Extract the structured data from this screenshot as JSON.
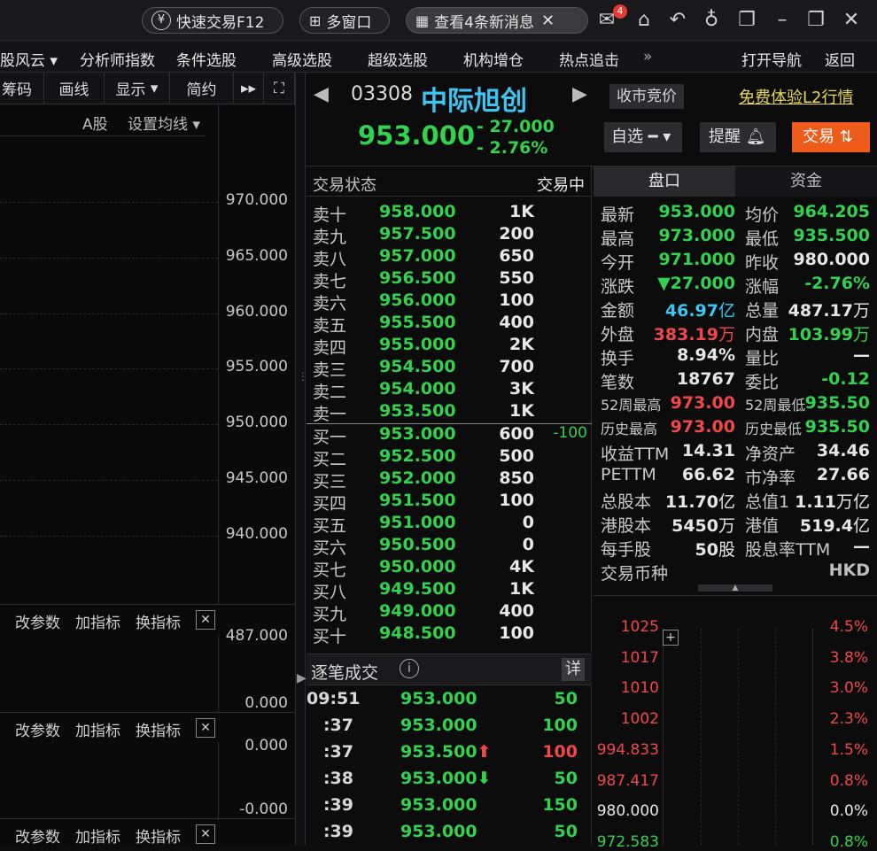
{
  "topbar": {
    "quick_trade": "快速交易F12",
    "multi_window": "多窗口",
    "messages": "查看4条新消息",
    "badge": "4"
  },
  "menu": {
    "items": [
      "股风云",
      "分析师指数",
      "条件选股",
      "高级选股",
      "超级选股",
      "机构增仓",
      "热点追击"
    ],
    "more": "»",
    "nav": "打开导航",
    "back": "返回"
  },
  "left": {
    "tools": [
      "筹码",
      "画线",
      "显示",
      "简约"
    ],
    "ashare": "A股",
    "ma_setting": "设置均线",
    "yaxis": [
      "970.000",
      "965.000",
      "960.000",
      "955.000",
      "950.000",
      "945.000",
      "940.000"
    ],
    "sub1": {
      "labels": [
        "改参数",
        "加指标",
        "换指标"
      ],
      "top": "487.000",
      "bottom": "0.000"
    },
    "sub2": {
      "labels": [
        "改参数",
        "加指标",
        "换指标"
      ],
      "top": "0.000",
      "bottom": "-0.000"
    },
    "sub3": {
      "labels": [
        "改参数",
        "加指标",
        "换指标"
      ]
    }
  },
  "quote": {
    "code": "03308",
    "name": "中际旭创",
    "status_btn": "收市竞价",
    "l2": "免费体验L2行情",
    "price": "953.000",
    "change": "- 27.000",
    "change_pct": "- 2.76%",
    "watch": "自选",
    "remind": "提醒",
    "trade": "交易"
  },
  "book": {
    "status_label": "交易状态",
    "status": "交易中",
    "sells": [
      [
        "卖十",
        "958.000",
        "1K"
      ],
      [
        "卖九",
        "957.500",
        "200"
      ],
      [
        "卖八",
        "957.000",
        "650"
      ],
      [
        "卖七",
        "956.500",
        "550"
      ],
      [
        "卖六",
        "956.000",
        "100"
      ],
      [
        "卖五",
        "955.500",
        "400"
      ],
      [
        "卖四",
        "955.000",
        "2K"
      ],
      [
        "卖三",
        "954.500",
        "700"
      ],
      [
        "卖二",
        "954.000",
        "3K"
      ],
      [
        "卖一",
        "953.500",
        "1K"
      ]
    ],
    "buys": [
      [
        "买一",
        "953.000",
        "600",
        "-100"
      ],
      [
        "买二",
        "952.500",
        "500",
        ""
      ],
      [
        "买三",
        "952.000",
        "850",
        ""
      ],
      [
        "买四",
        "951.500",
        "100",
        ""
      ],
      [
        "买五",
        "951.000",
        "0",
        ""
      ],
      [
        "买六",
        "950.500",
        "0",
        ""
      ],
      [
        "买七",
        "950.000",
        "4K",
        ""
      ],
      [
        "买八",
        "949.500",
        "1K",
        ""
      ],
      [
        "买九",
        "949.000",
        "400",
        ""
      ],
      [
        "买十",
        "948.500",
        "100",
        ""
      ]
    ]
  },
  "tabs": {
    "pankou": "盘口",
    "funds": "资金"
  },
  "stats": [
    {
      "l1": "最新",
      "v1": "953.000",
      "c1": "g",
      "l2": "均价",
      "v2": "964.205",
      "c2": "g"
    },
    {
      "l1": "最高",
      "v1": "973.000",
      "c1": "g",
      "l2": "最低",
      "v2": "935.500",
      "c2": "g"
    },
    {
      "l1": "今开",
      "v1": "971.000",
      "c1": "g",
      "l2": "昨收",
      "v2": "980.000",
      "c2": "w"
    },
    {
      "l1": "涨跌",
      "v1": "▼27.000",
      "c1": "g",
      "l2": "涨幅",
      "v2": "-2.76%",
      "c2": "g"
    },
    {
      "l1": "金额",
      "v1": "46.97",
      "u1": "亿",
      "c1": "c",
      "l2": "总量",
      "v2": "487.17",
      "u2": "万",
      "c2": "w"
    },
    {
      "l1": "外盘",
      "v1": "383.19",
      "u1": "万",
      "c1": "r",
      "l2": "内盘",
      "v2": "103.99",
      "u2": "万",
      "c2": "g"
    },
    {
      "l1": "换手",
      "v1": "8.94%",
      "c1": "w",
      "l2": "量比",
      "v2": "—",
      "c2": "w"
    },
    {
      "l1": "笔数",
      "v1": "18767",
      "c1": "w",
      "l2": "委比",
      "v2": "-0.12",
      "c2": "g"
    },
    {
      "l1": "52周最高",
      "v1": "973.00",
      "c1": "r",
      "l2": "52周最低",
      "v2": "935.50",
      "c2": "g",
      "small": true
    },
    {
      "l1": "历史最高",
      "v1": "973.00",
      "c1": "r",
      "l2": "历史最低",
      "v2": "935.50",
      "c2": "g",
      "small": true
    },
    {
      "l1": "收益TTM",
      "v1": "14.31",
      "c1": "w",
      "l2": "净资产",
      "v2": "34.46",
      "c2": "w"
    },
    {
      "l1": "PETTM",
      "v1": "66.62",
      "c1": "w",
      "l2": "市净率",
      "v2": "27.66",
      "c2": "w"
    },
    {
      "l1": "总股本",
      "v1": "11.70",
      "u1": "亿",
      "c1": "w",
      "l2": "总值1",
      "v2": "1.11",
      "u2": "万亿",
      "c2": "w"
    },
    {
      "l1": "港股本",
      "v1": "5450",
      "u1": "万",
      "c1": "w",
      "l2": "港值",
      "v2": "519.4",
      "u2": "亿",
      "c2": "w"
    },
    {
      "l1": "每手股",
      "v1": "50",
      "u1": "股",
      "c1": "w",
      "l2": "股息率TTM",
      "v2": "—",
      "c2": "w"
    },
    {
      "l1": "交易币种",
      "v1": "",
      "c1": "w",
      "l2": "",
      "v2": "HKD",
      "c2": "gr"
    }
  ],
  "ticks": {
    "title": "逐笔成交",
    "detail": "详",
    "rows": [
      [
        "09:51",
        "953.000",
        "50",
        "g",
        "g",
        ""
      ],
      [
        ":37",
        "953.000",
        "100",
        "g",
        "g",
        ""
      ],
      [
        ":37",
        "953.500",
        "100",
        "g",
        "r",
        "up"
      ],
      [
        ":38",
        "953.000",
        "50",
        "g",
        "g",
        "down"
      ],
      [
        ":39",
        "953.000",
        "150",
        "g",
        "g",
        ""
      ],
      [
        ":39",
        "953.000",
        "50",
        "g",
        "g",
        ""
      ]
    ]
  },
  "mini": {
    "left": [
      [
        "1025",
        "r"
      ],
      [
        "1017",
        "r"
      ],
      [
        "1010",
        "r"
      ],
      [
        "1002",
        "r"
      ],
      [
        "994.833",
        "r"
      ],
      [
        "987.417",
        "r"
      ],
      [
        "980.000",
        "w"
      ],
      [
        "972.583",
        "g"
      ]
    ],
    "right": [
      [
        "4.5%",
        "r"
      ],
      [
        "3.8%",
        "r"
      ],
      [
        "3.0%",
        "r"
      ],
      [
        "2.3%",
        "r"
      ],
      [
        "1.5%",
        "r"
      ],
      [
        "0.8%",
        "r"
      ],
      [
        "0.0%",
        "w"
      ],
      [
        "0.8%",
        "g"
      ]
    ]
  }
}
